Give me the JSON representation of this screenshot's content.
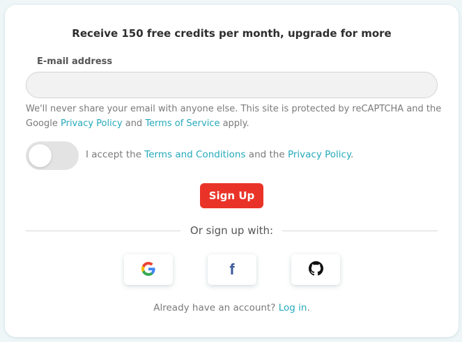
{
  "headline": "Receive 150 free credits per month, upgrade for more",
  "email": {
    "label": "E-mail address",
    "value": "",
    "placeholder": ""
  },
  "help": {
    "text_before": "We'll never share your email with anyone else. This site is protected by reCAPTCHA and the Google ",
    "privacy_link": "Privacy Policy",
    "text_middle": " and ",
    "terms_link": "Terms of Service",
    "text_after": " apply."
  },
  "accept": {
    "checked": false,
    "text_before": "I accept the ",
    "terms_link": "Terms and Conditions",
    "text_middle": " and the ",
    "privacy_link": "Privacy Policy",
    "text_after": "."
  },
  "signup_button": "Sign Up",
  "divider_text": "Or sign up with:",
  "social": {
    "google_icon": "google-icon",
    "facebook_icon": "facebook-icon",
    "facebook_glyph": "f",
    "github_icon": "github-icon"
  },
  "login": {
    "prompt": "Already have an account? ",
    "link": "Log in",
    "suffix": "."
  },
  "colors": {
    "accent_link": "#25a9bb",
    "signup_red": "#ea3328",
    "facebook_blue": "#3b5998"
  }
}
